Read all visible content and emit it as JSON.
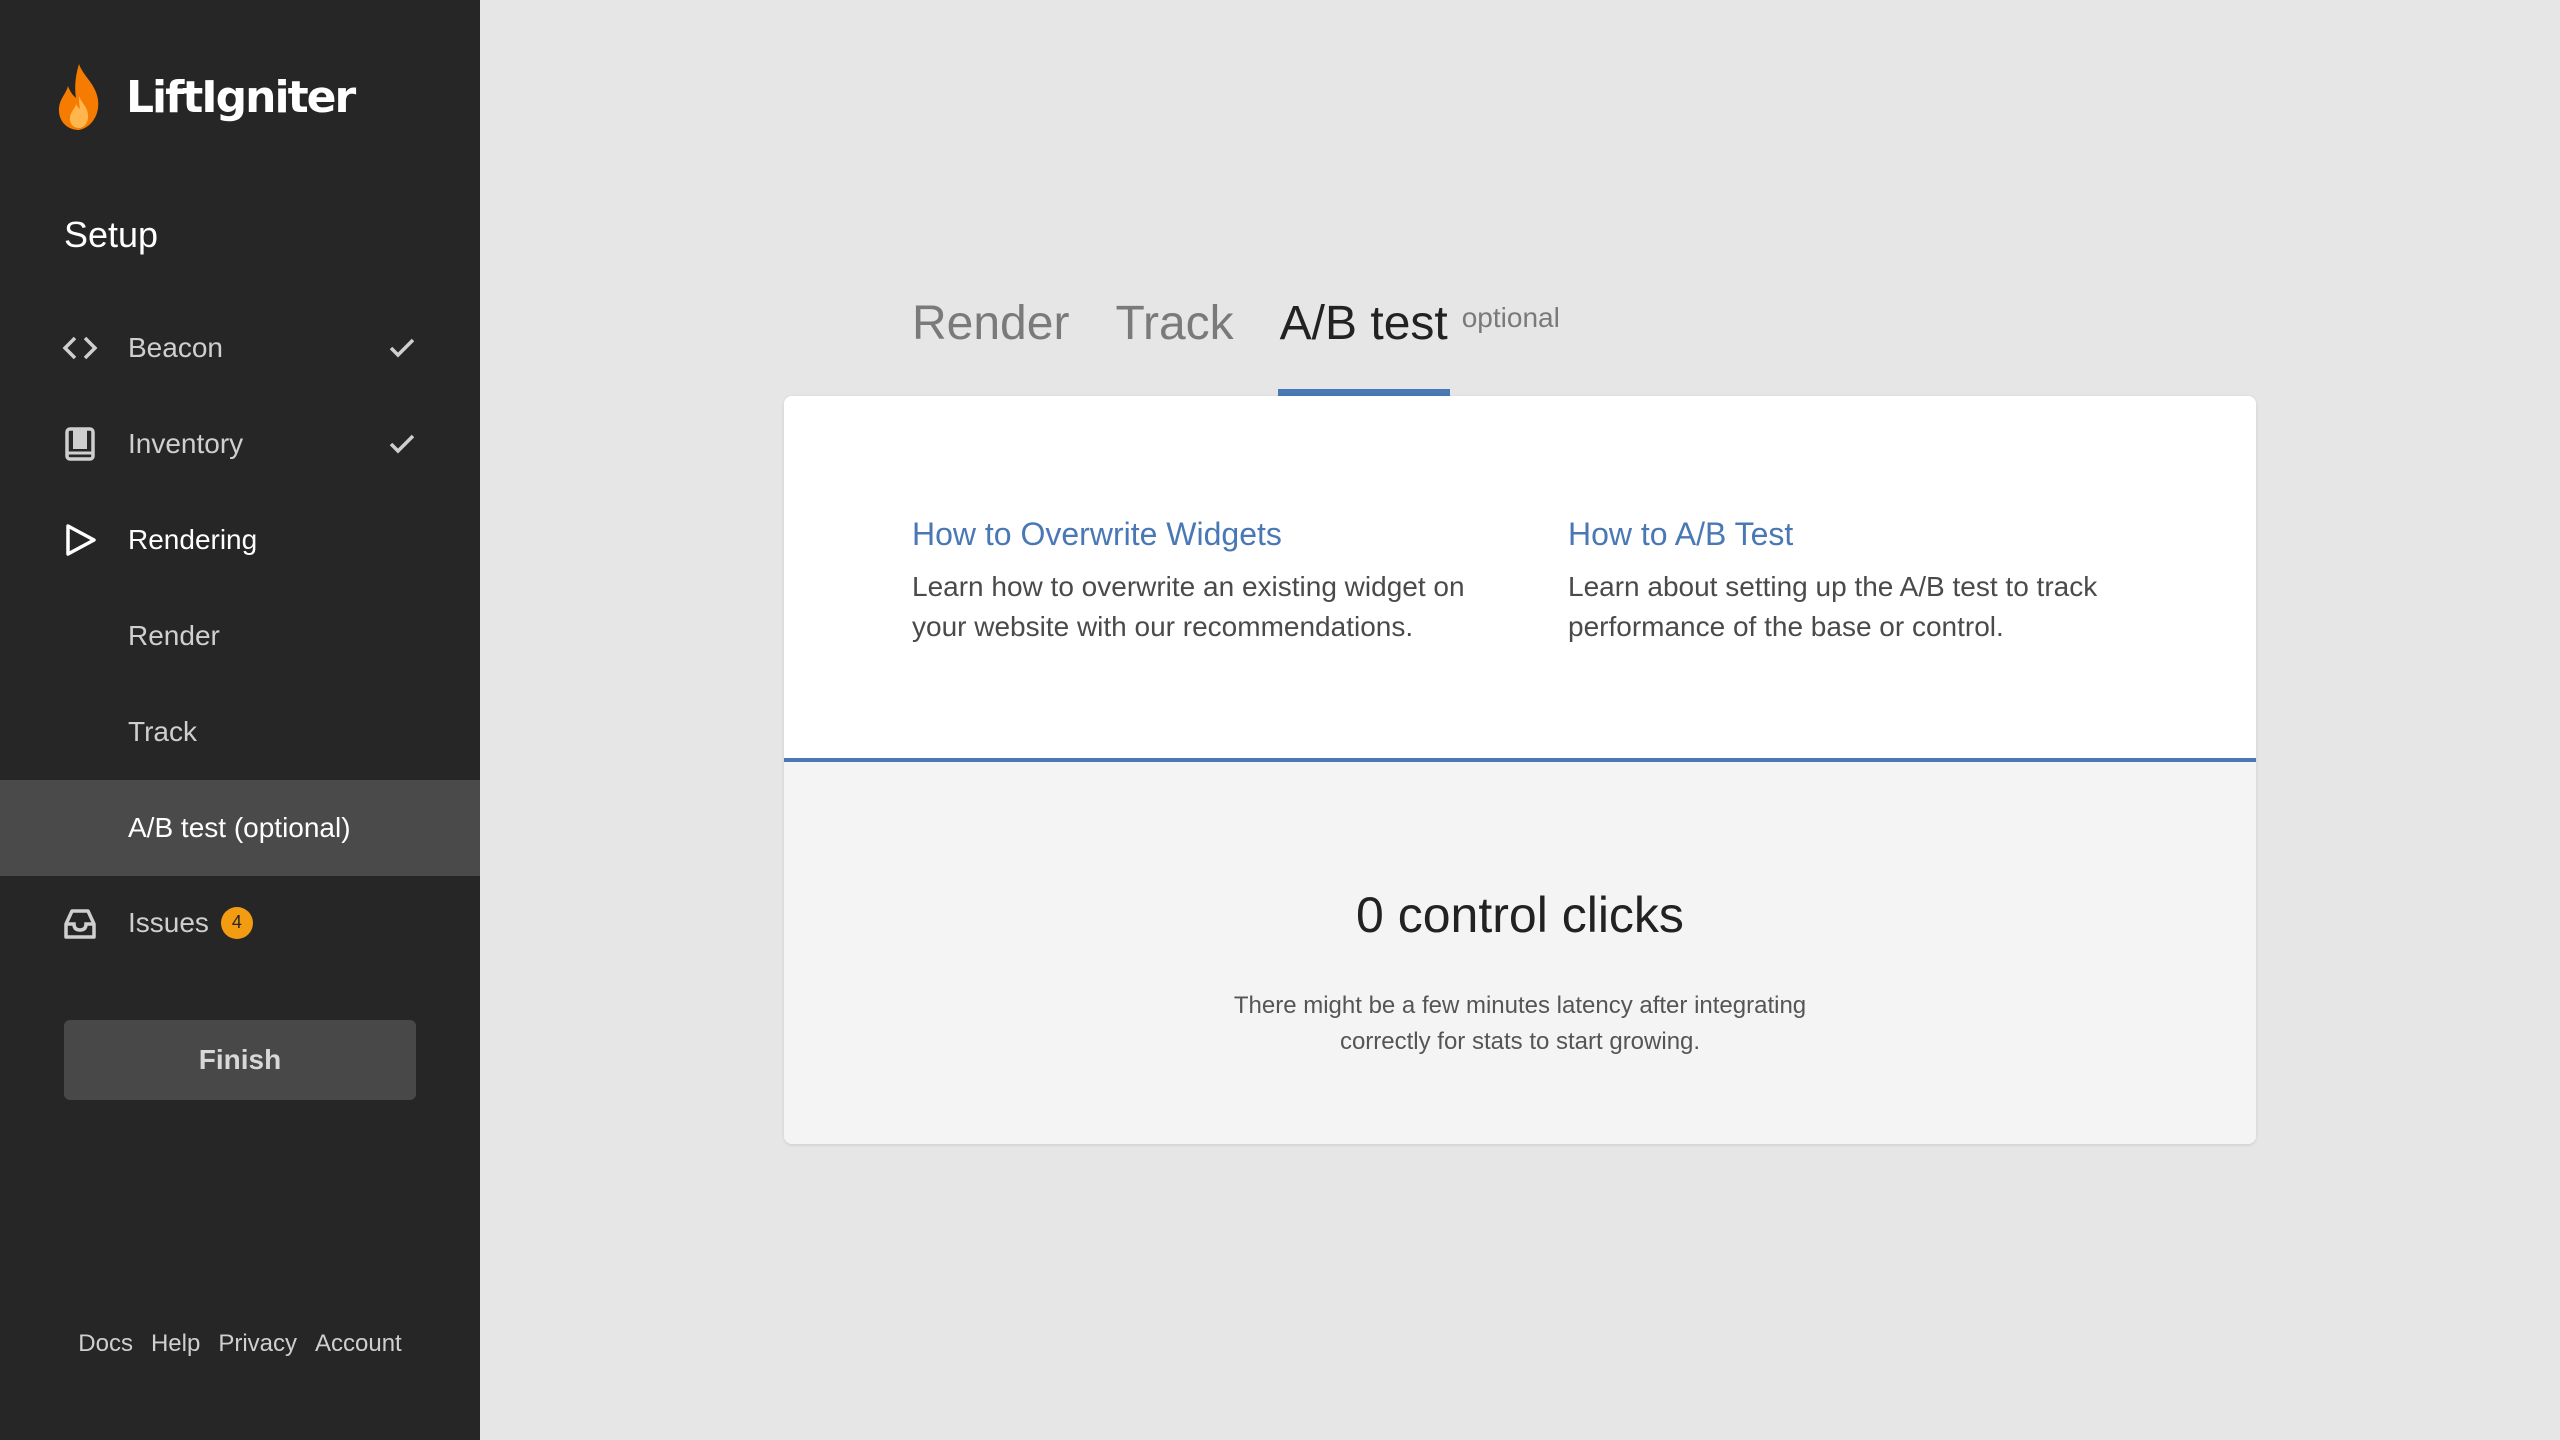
{
  "brand": {
    "name": "LiftIgniter",
    "flame_color": "#f57c00"
  },
  "sidebar": {
    "section_title": "Setup",
    "items": [
      {
        "label": "Beacon",
        "icon": "code-icon",
        "checked": true
      },
      {
        "label": "Inventory",
        "icon": "book-icon",
        "checked": true
      },
      {
        "label": "Rendering",
        "icon": "play-icon",
        "checked": false
      },
      {
        "label": "Render",
        "sub": true
      },
      {
        "label": "Track",
        "sub": true
      },
      {
        "label": "A/B test (optional)",
        "sub": true,
        "active": true
      },
      {
        "label": "Issues",
        "icon": "inbox-icon",
        "badge": "4"
      }
    ],
    "finish_label": "Finish",
    "footer": [
      "Docs",
      "Help",
      "Privacy",
      "Account"
    ]
  },
  "main": {
    "tabs": [
      {
        "label": "Render"
      },
      {
        "label": "Track"
      },
      {
        "label": "A/B test",
        "active": true
      }
    ],
    "tab_note": "optional",
    "articles": [
      {
        "title": "How to Overwrite Widgets",
        "desc": "Learn how to overwrite an existing widget on your website with our recommendations."
      },
      {
        "title": "How to A/B Test",
        "desc": "Learn about setting up the A/B test to track performance of the base or control."
      }
    ],
    "stat": "0 control clicks",
    "latency_note": "There might be a few minutes latency after integrating correctly for stats to start growing."
  },
  "colors": {
    "sidebar_bg": "#262626",
    "accent": "#4a78b5",
    "badge": "#f39c12",
    "page_bg": "#e6e6e6"
  }
}
